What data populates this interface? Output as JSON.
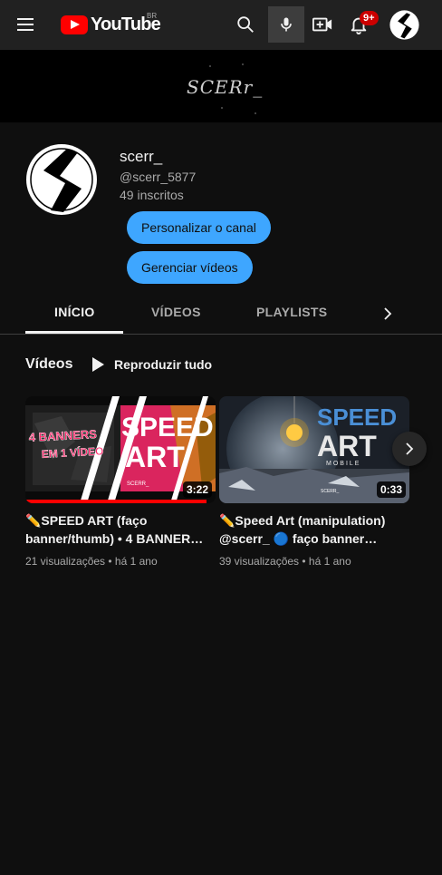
{
  "topbar": {
    "logo_text": "YouTube",
    "region": "BR",
    "notifications_badge": "9+"
  },
  "banner": {
    "text": "SCERr_"
  },
  "channel": {
    "name": "scerr_",
    "handle": "@scerr_5877",
    "subscribers": "49 inscritos",
    "customize_label": "Personalizar o canal",
    "manage_label": "Gerenciar vídeos"
  },
  "tabs": [
    {
      "label": "INÍCIO",
      "active": true
    },
    {
      "label": "VÍDEOS",
      "active": false
    },
    {
      "label": "PLAYLISTS",
      "active": false
    }
  ],
  "section": {
    "title": "Vídeos",
    "play_all_label": "Reproduzir tudo"
  },
  "videos": [
    {
      "title": "✏️SPEED ART (faço banner/thumb) • 4 BANNER…",
      "duration": "3:22",
      "meta": "21 visualizações • há 1 ano",
      "watched_fraction": 0.95,
      "thumb_text_1": "4 BANNERS",
      "thumb_text_2": "EM 1 VÍDEO",
      "thumb_text_3": "SPEED",
      "thumb_text_4": "ART",
      "thumb_sig": "SCERR_"
    },
    {
      "title": "✏️Speed Art (manipulation) @scerr_ 🔵 faço banner…",
      "duration": "0:33",
      "meta": "39 visualizações • há 1 ano",
      "thumb_text_1": "SPEED",
      "thumb_text_2": "ART",
      "thumb_text_3": "MOBILE",
      "thumb_sig": "SCERR_"
    }
  ],
  "colors": {
    "accent_button": "#3ea6ff",
    "youtube_red": "#ff0000",
    "badge_red": "#cc0000",
    "background": "#0f0f0f",
    "topbar": "#212121",
    "thumb1_pink": "#ff2a6d"
  },
  "icons": [
    "menu-icon",
    "youtube-logo-icon",
    "search-icon",
    "microphone-icon",
    "create-video-icon",
    "bell-icon",
    "chevron-right-icon",
    "play-icon"
  ]
}
